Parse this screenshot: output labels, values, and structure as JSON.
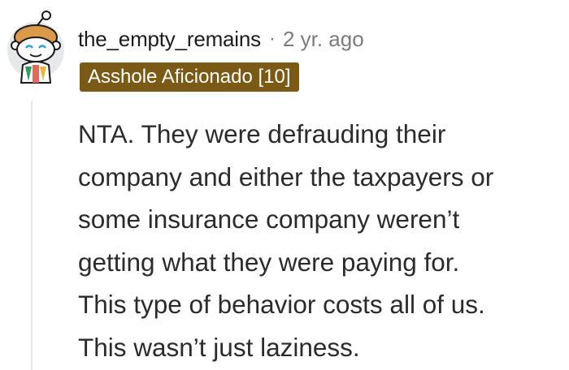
{
  "comment": {
    "username": "the_empty_remains",
    "separator": "·",
    "timestamp": "2 yr. ago",
    "flair": "Asshole Aficionado [10]",
    "body_lines": [
      "NTA. They were defrauding their",
      "company and either the taxpayers or",
      "some insurance company weren’t",
      "getting what they were paying for.",
      "This type of behavior costs all of us.",
      "This wasn’t just laziness."
    ]
  },
  "colors": {
    "flair_background": "#7a5a14",
    "text": "#2b2b2b",
    "meta": "#7c7c7c"
  }
}
